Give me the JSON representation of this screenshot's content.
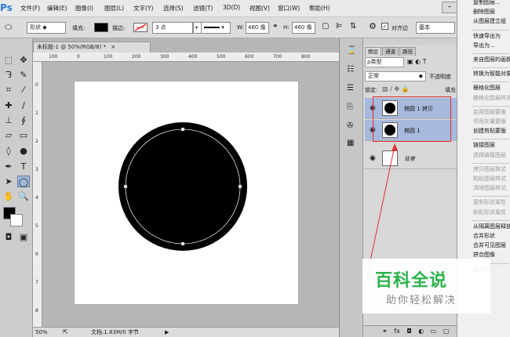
{
  "app": {
    "logo": "Ps"
  },
  "menubar": [
    "文件(F)",
    "编辑(E)",
    "图像(I)",
    "图层(L)",
    "文字(Y)",
    "选择(S)",
    "滤镜(T)",
    "3D(D)",
    "视图(V)",
    "窗口(W)",
    "帮助(H)"
  ],
  "window_min": "–",
  "options": {
    "mode": "形状",
    "fill_label": "填充:",
    "stroke_label": "描边:",
    "stroke_width": "3 点",
    "w_label": "W:",
    "w_value": "460 像",
    "h_label": "H:",
    "h_value": "460 像",
    "align_edges_label": "对齐边",
    "preset": "基本"
  },
  "document": {
    "tab_title": "未标题-1 @ 50%(RGB/8) *",
    "tab_close": "×",
    "zoom": "50%",
    "doc_info": "文档:1.83M/0 字节",
    "ruler_top": [
      "100",
      "0",
      "100",
      "200",
      "300",
      "400",
      "500",
      "600",
      "700",
      "800"
    ],
    "ruler_left": [
      "0",
      "1",
      "2",
      "3",
      "4",
      "5",
      "6",
      "7",
      "8",
      "9"
    ]
  },
  "layers_panel": {
    "tabs": [
      "图层",
      "通道",
      "路径"
    ],
    "filter_type": "ρ类型",
    "blend_mode": "正常",
    "opacity_label": "不透明度",
    "lock_label": "锁定:",
    "fill_label": "填充",
    "layers": [
      {
        "name": "椭圆 1 拷贝",
        "selected": true
      },
      {
        "name": "椭圆 1",
        "selected": true
      },
      {
        "name": "背景",
        "selected": false
      }
    ],
    "footer_icons": [
      "link-icon",
      "fx-icon",
      "mask-icon",
      "adjustment-icon",
      "folder-icon",
      "new-layer-icon",
      "trash-icon"
    ]
  },
  "context_menu": {
    "items": [
      {
        "label": "复制图层...",
        "disabled": false
      },
      {
        "label": "删除图层",
        "disabled": false
      },
      {
        "label": "从图层建立组",
        "disabled": false
      },
      {
        "sep": true
      },
      {
        "label": "快速导出为",
        "disabled": false
      },
      {
        "label": "导出为...",
        "disabled": false
      },
      {
        "sep": true
      },
      {
        "label": "来自图层的画板",
        "disabled": false
      },
      {
        "sep": true
      },
      {
        "label": "转换为智能对象",
        "disabled": false
      },
      {
        "sep": true
      },
      {
        "label": "栅格化图层",
        "disabled": false
      },
      {
        "label": "栅格化图层样式",
        "disabled": true
      },
      {
        "sep": true
      },
      {
        "label": "启用图层蒙版",
        "disabled": true
      },
      {
        "label": "停用矢量蒙版",
        "disabled": true
      },
      {
        "label": "创建剪贴蒙版",
        "disabled": false
      },
      {
        "sep": true
      },
      {
        "label": "链接图层",
        "disabled": false
      },
      {
        "label": "选择链接图层",
        "disabled": true
      },
      {
        "sep": true
      },
      {
        "label": "拷贝图层样式",
        "disabled": true
      },
      {
        "label": "粘贴图层样式",
        "disabled": true
      },
      {
        "label": "清除图层样式",
        "disabled": true
      },
      {
        "sep": true
      },
      {
        "label": "复制形状属性",
        "disabled": true
      },
      {
        "label": "粘贴形状属性",
        "disabled": true
      },
      {
        "sep": true
      },
      {
        "label": "从隔离图层释放",
        "disabled": false
      },
      {
        "label": "合并形状",
        "disabled": false
      },
      {
        "label": "合并可见图层",
        "disabled": false
      },
      {
        "label": "拼合图像",
        "disabled": false
      },
      {
        "sep": true
      },
      {
        "label": "无颜色",
        "disabled": false
      }
    ]
  },
  "watermark": {
    "title": "百科全说",
    "subtitle": "助你轻松解决"
  },
  "colors": {
    "selection": "#a7b9dd",
    "annotation": "#e03030",
    "watermark_green": "#2cb24a"
  }
}
